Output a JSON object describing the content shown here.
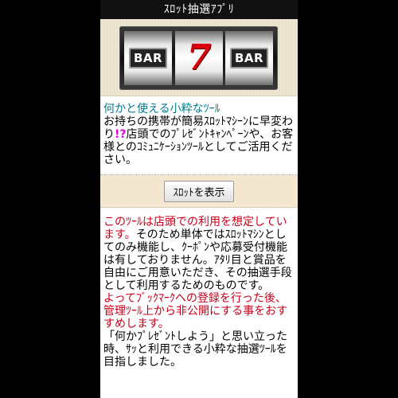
{
  "app": {
    "title": "ｽﾛｯﾄ抽選ｱﾌﾟﾘ"
  },
  "banner": {
    "reels": [
      "BAR",
      "7",
      "BAR"
    ]
  },
  "intro": {
    "heading": "何かと使える小粋なﾂｰﾙ",
    "body_before": "お持ちの携帯が簡易ｽﾛｯﾄﾏｼｰﾝに早変わり",
    "exclaim": "!?",
    "body_after": "店頭でのﾌﾟﾚｾﾞﾝﾄｷｬﾝﾍﾟｰﾝや、お客様とのｺﾐｭﾆｹｰｼｮﾝﾂｰﾙとしてご活用ください。"
  },
  "action": {
    "show_slot_label": "ｽﾛｯﾄを表示"
  },
  "notes": {
    "paragraph1_red": "このﾂｰﾙは店頭での利用を想定しています。",
    "paragraph1_black": "そのため単体ではｽﾛｯﾄﾏｼﾝとしてのみ機能し、ｸｰﾎﾟﾝや応募受付機能は有しておりません。ｱﾀﾘ目と賞品を自由にご用意いただき、その抽選手段として利用するためのものです。",
    "paragraph2_red": "よってﾌﾞｯｸﾏｰｸへの登録を行った後、管理ﾂｰﾙ上から非公開にする事をおすすめします。",
    "paragraph3_black": "「何かﾌﾟﾚｾﾞﾝﾄしよう」と思い立った時、ｻｯと利用できる小粋な抽選ﾂｰﾙを目指しました。"
  },
  "colors": {
    "heading": "#007b8c",
    "warning": "#c8001a",
    "button_band": "#f4e7cf",
    "titlebar": "#111111"
  }
}
